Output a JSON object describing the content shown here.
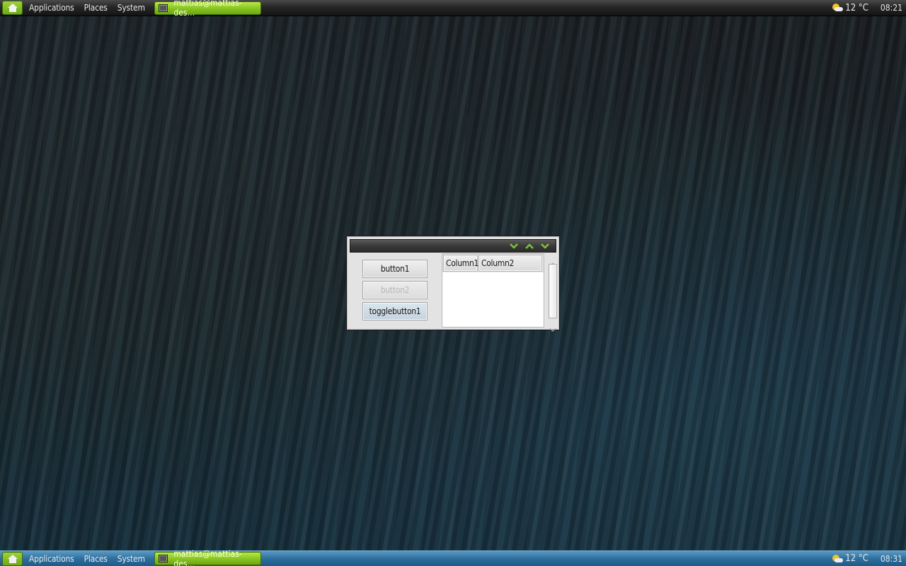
{
  "top_panel": {
    "menu": [
      "Applications",
      "Places",
      "System"
    ],
    "task": {
      "label": "mattias@mattias-des…",
      "icon": "terminal-icon"
    },
    "weather": {
      "temperature": "12 °C",
      "icon": "partly-cloudy-icon"
    },
    "clock": "08:21"
  },
  "bottom_panel": {
    "menu": [
      "Applications",
      "Places",
      "System"
    ],
    "task": {
      "label": "mattias@mattias-des…",
      "icon": "terminal-icon"
    },
    "weather": {
      "temperature": "12 °C",
      "icon": "partly-cloudy-icon"
    },
    "clock": "08:31"
  },
  "window": {
    "title": "",
    "titlebar_buttons": [
      "minimize",
      "maximize",
      "close"
    ],
    "buttons": [
      {
        "label": "button1",
        "state": "normal"
      },
      {
        "label": "button2",
        "state": "disabled"
      },
      {
        "label": "togglebutton1",
        "state": "toggle"
      }
    ],
    "treeview": {
      "columns": [
        "Column1",
        "Column2"
      ],
      "rows": []
    }
  },
  "colors": {
    "accent_green": "#86c220",
    "titlebar_icon_green": "#7ac43a",
    "top_panel": "#262626",
    "bottom_panel": "#2e6f9e"
  }
}
